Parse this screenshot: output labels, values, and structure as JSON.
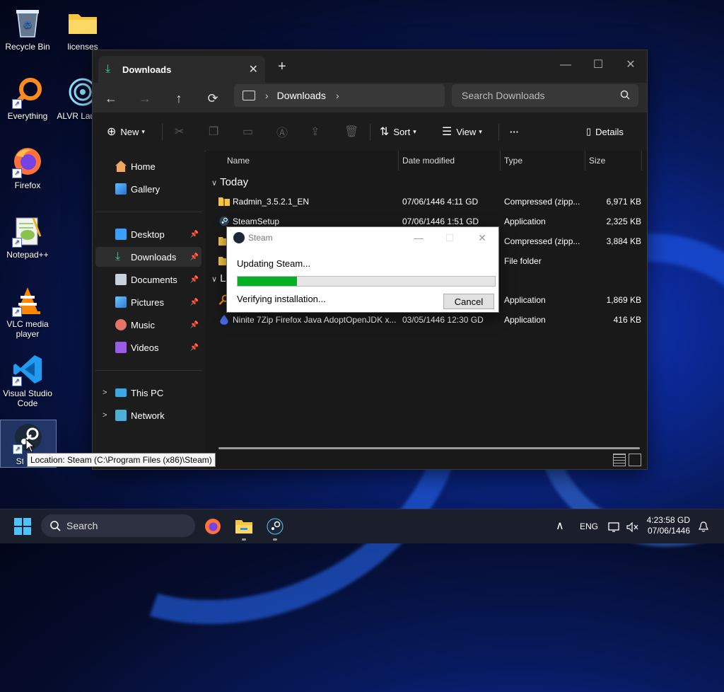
{
  "desktop": {
    "icons": [
      {
        "label": "Recycle Bin"
      },
      {
        "label": "licenses"
      },
      {
        "label": "Everything"
      },
      {
        "label": "ALVR Launch"
      },
      {
        "label": "Firefox"
      },
      {
        "label": "Notepad++"
      },
      {
        "label": "VLC media player"
      },
      {
        "label": "Visual Studio Code"
      },
      {
        "label": "Steam"
      }
    ],
    "tooltip": "Location: Steam (C:\\Program Files (x86)\\Steam)"
  },
  "explorer": {
    "tab_title": "Downloads",
    "address": {
      "crumb": "Downloads"
    },
    "search_placeholder": "Search Downloads",
    "commands": {
      "new": "New",
      "sort": "Sort",
      "view": "View",
      "more": "···",
      "details": "Details"
    },
    "sidebar": {
      "home": "Home",
      "gallery": "Gallery",
      "desktop": "Desktop",
      "downloads": "Downloads",
      "documents": "Documents",
      "pictures": "Pictures",
      "music": "Music",
      "videos": "Videos",
      "this_pc": "This PC",
      "network": "Network"
    },
    "columns": {
      "name": "Name",
      "date": "Date modified",
      "type": "Type",
      "size": "Size"
    },
    "groups": {
      "today": "Today",
      "last": "L"
    },
    "files": [
      {
        "name": "Radmin_3.5.2.1_EN",
        "date": "07/06/1446 4:11 GD",
        "type": "Compressed (zipp...",
        "size": "6,971 KB"
      },
      {
        "name": "SteamSetup",
        "date": "07/06/1446 1:51 GD",
        "type": "Application",
        "size": "2,325 KB"
      },
      {
        "name": "",
        "date": "",
        "type": "Compressed (zipp...",
        "size": "3,884 KB"
      },
      {
        "name": "",
        "date": "",
        "type": "File folder",
        "size": ""
      },
      {
        "name": "",
        "date": "",
        "type": "Application",
        "size": "1,869 KB"
      },
      {
        "name": "Ninite 7Zip Firefox Java AdoptOpenJDK x...",
        "date": "03/05/1446 12:30 GD",
        "type": "Application",
        "size": "416 KB"
      }
    ]
  },
  "steam_dialog": {
    "title": "Steam",
    "status": "Updating Steam...",
    "progress": 0.23,
    "detail": "Verifying installation...",
    "cancel": "Cancel"
  },
  "taskbar": {
    "search": "Search",
    "lang": "ENG",
    "time": "4:23:58 GD",
    "date": "07/06/1446"
  },
  "colors": {
    "accent": "#4cc2ff",
    "progress": "#06b025",
    "downloads_icon": "#3ec9a0"
  }
}
